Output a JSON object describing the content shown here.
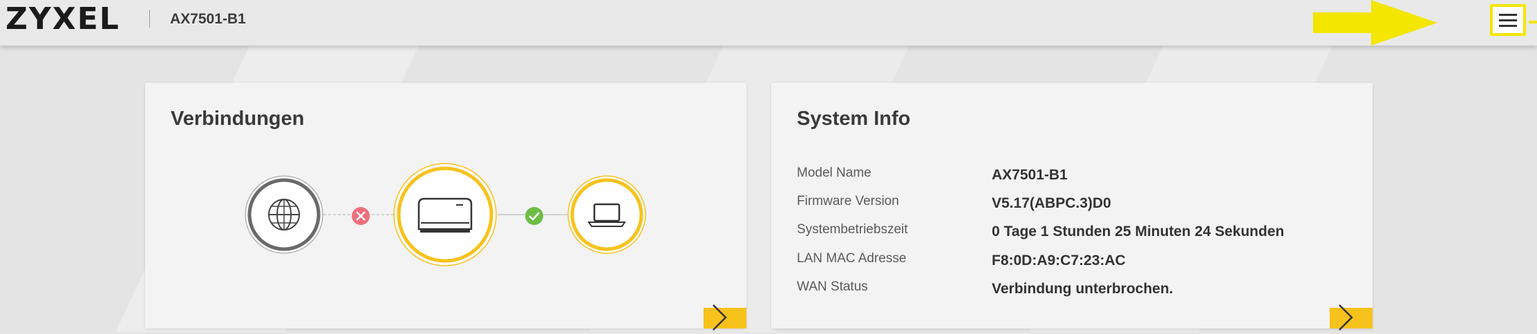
{
  "header": {
    "logo": "ZYXEL",
    "model": "AX7501-B1",
    "menu_icon": "hamburger-menu-icon",
    "annotation_arrow_color": "#f3e600"
  },
  "connections_card": {
    "title": "Verbindungen",
    "nodes": [
      "globe-icon",
      "router-icon",
      "laptop-icon"
    ],
    "links": [
      {
        "status": "disconnected",
        "icon": "error-x-icon",
        "color": "#ee6e7b"
      },
      {
        "status": "connected",
        "icon": "checkmark-icon",
        "color": "#6cbd45"
      }
    ],
    "accent_color": "#f7c21c"
  },
  "system_info_card": {
    "title": "System Info",
    "rows": [
      {
        "label": "Model Name",
        "value": "AX7501-B1"
      },
      {
        "label": "Firmware Version",
        "value": "V5.17(ABPC.3)D0"
      },
      {
        "label": "Systembetriebszeit",
        "value": "0 Tage 1 Stunden 25 Minuten 24 Sekunden"
      },
      {
        "label": "LAN MAC Adresse",
        "value": "F8:0D:A9:C7:23:AC"
      },
      {
        "label": "WAN Status",
        "value": "Verbindung unterbrochen."
      }
    ]
  }
}
